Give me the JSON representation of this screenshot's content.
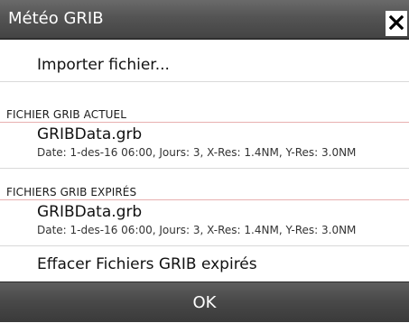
{
  "dialog": {
    "title": "Météo GRIB",
    "close_icon": "close-icon"
  },
  "actions": {
    "import_label": "Importer fichier...",
    "delete_expired_label": "Effacer Fichiers GRIB expirés"
  },
  "current_section": {
    "heading": "FICHIER GRIB ACTUEL",
    "file": {
      "name": "GRIBData.grb",
      "meta": "Date: 1-des-16 06:00, Jours: 3, X-Res: 1.4NM, Y-Res: 3.0NM"
    }
  },
  "expired_section": {
    "heading": "FICHIERS GRIB EXPIRÉS",
    "file": {
      "name": "GRIBData.grb",
      "meta": "Date: 1-des-16 06:00, Jours: 3, X-Res: 1.4NM, Y-Res: 3.0NM"
    }
  },
  "footer": {
    "ok_label": "OK"
  }
}
